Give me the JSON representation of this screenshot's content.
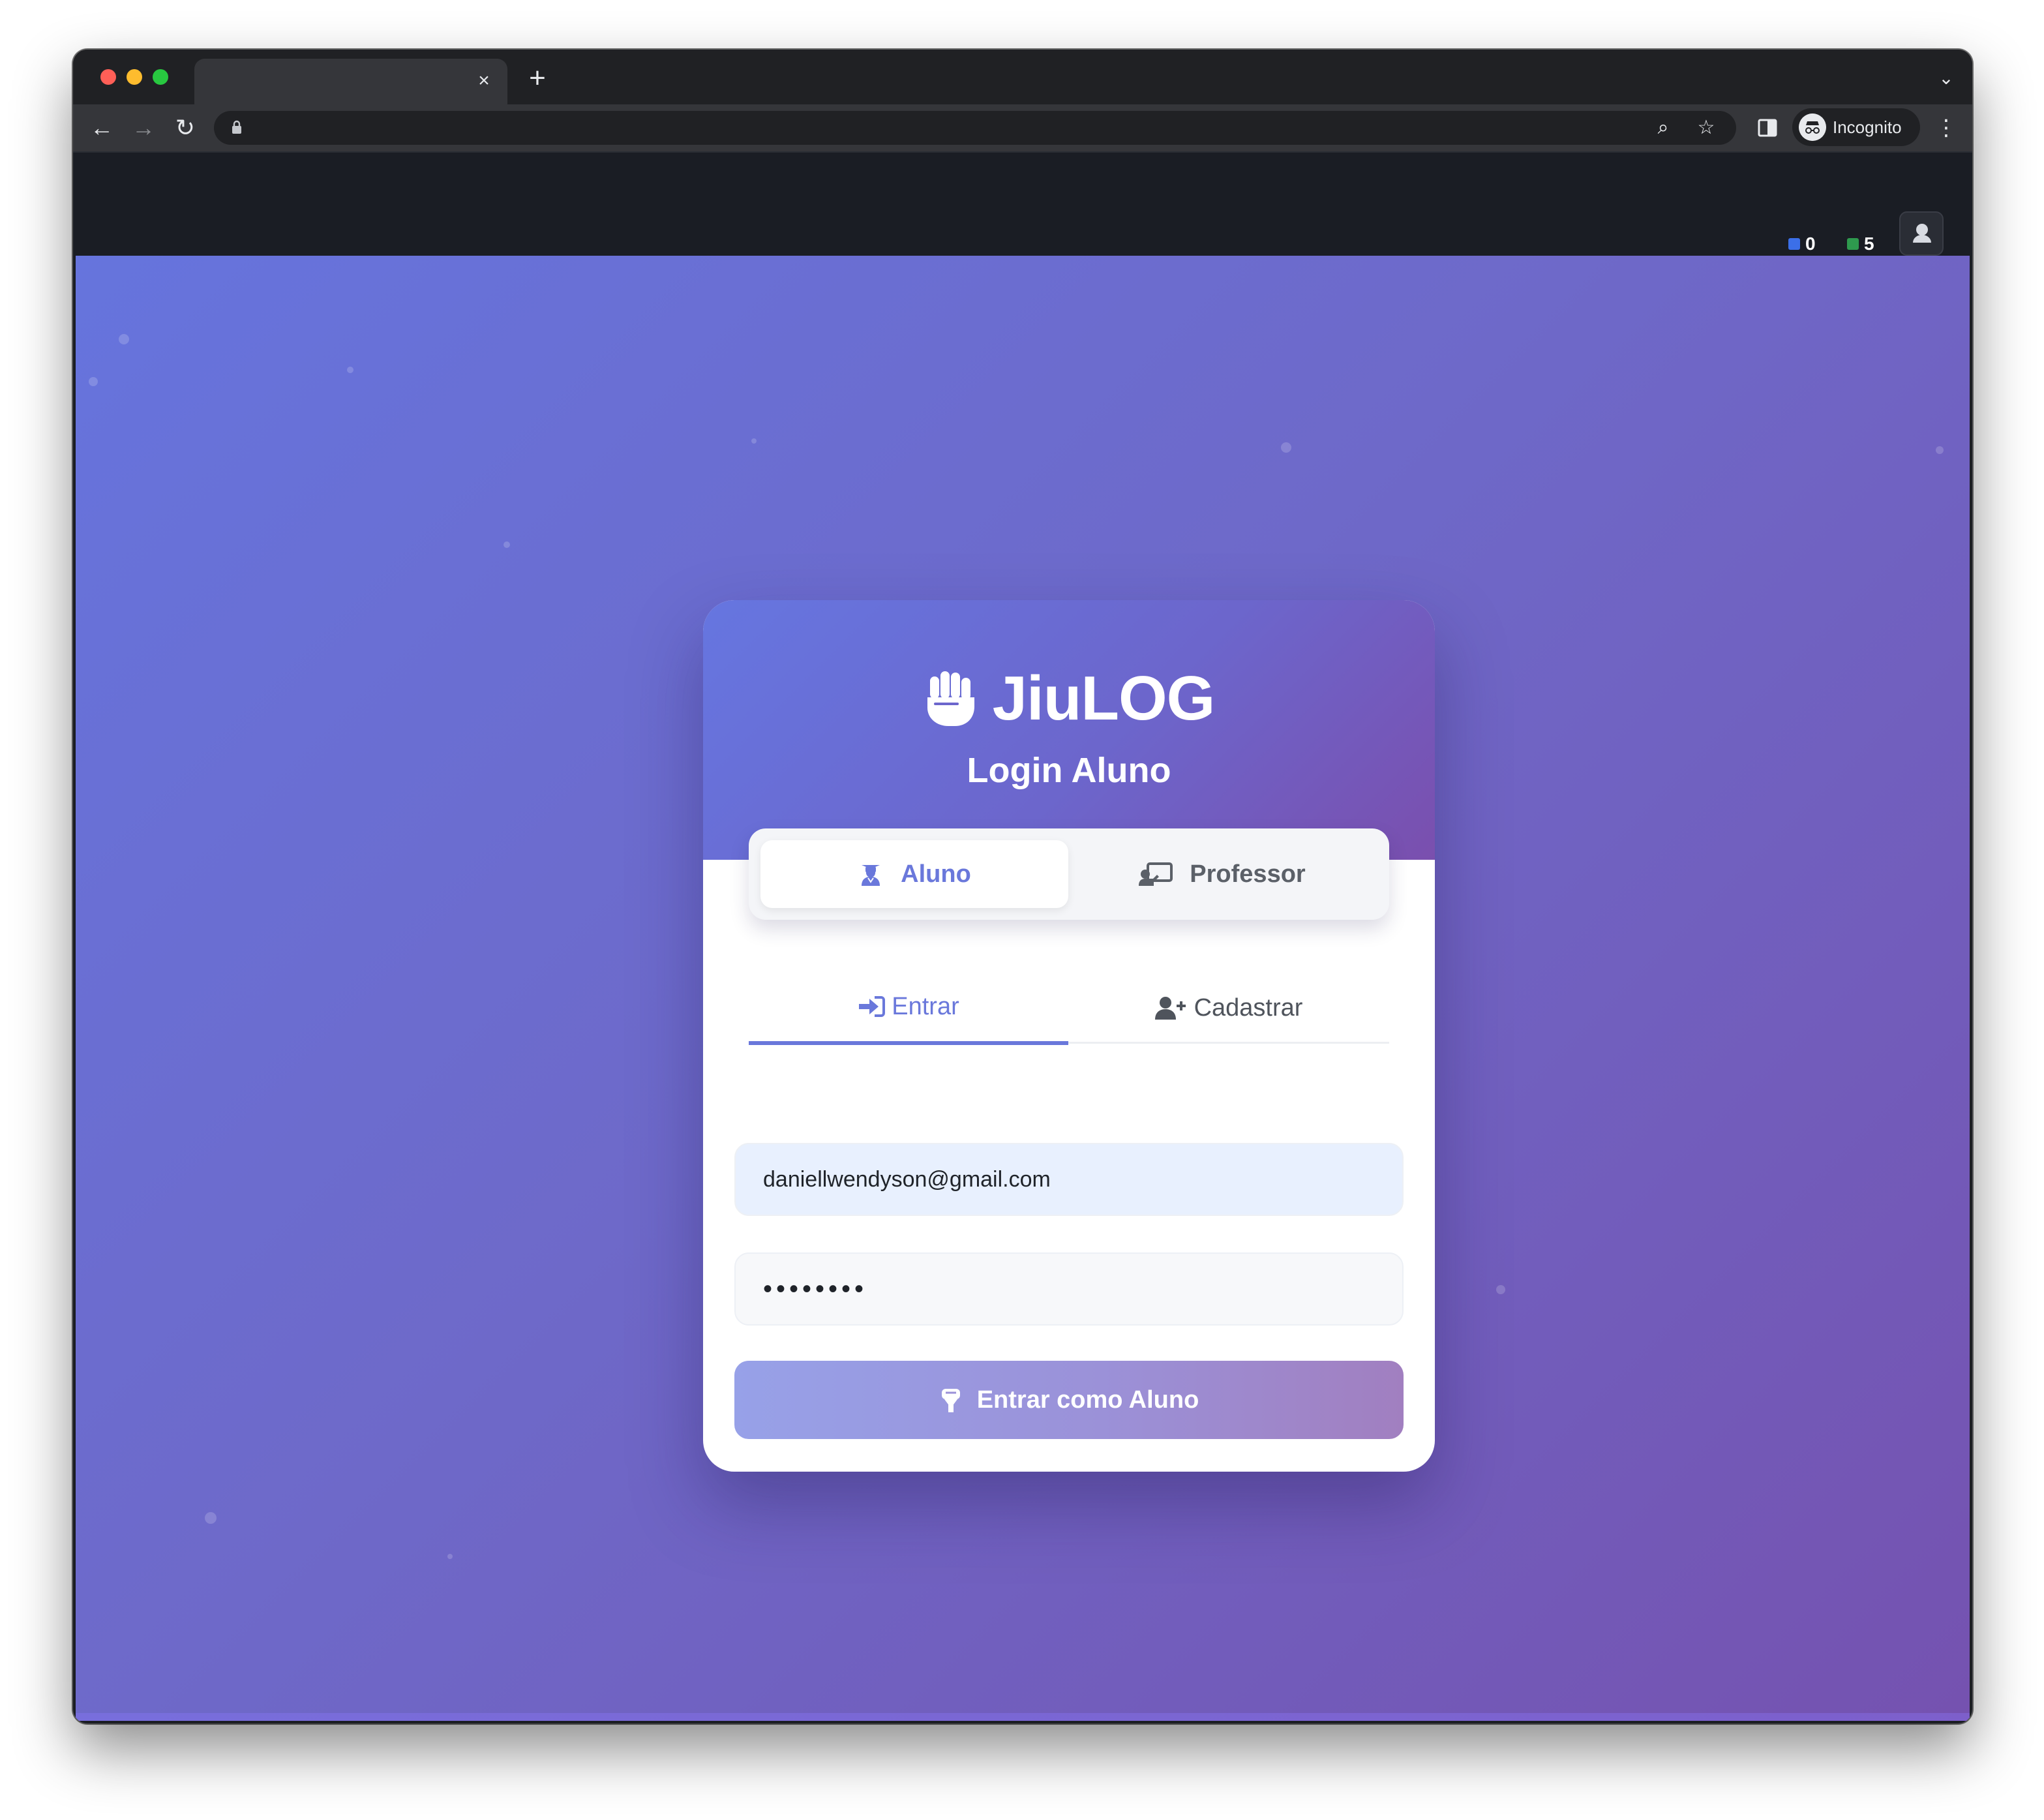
{
  "browser": {
    "tab_close_glyph": "×",
    "new_tab_glyph": "+",
    "tab_menu_glyph": "⌄",
    "back_glyph": "←",
    "forward_glyph": "→",
    "reload_glyph": "↻",
    "zoom_glyph": "⌕",
    "star_glyph": "☆",
    "kebab_glyph": "⋮",
    "incognito_label": "Incognito"
  },
  "header": {
    "counters": [
      {
        "value": "0",
        "color": "#3b6fe8"
      },
      {
        "value": "5",
        "color": "#2e9a4e"
      }
    ]
  },
  "card": {
    "brand": "JiuLOG",
    "subtitle": "Login Aluno",
    "role_tabs": [
      {
        "label": "Aluno",
        "icon": "graduate-icon",
        "active": true
      },
      {
        "label": "Professor",
        "icon": "chalkboard-teacher-icon",
        "active": false
      }
    ],
    "auth_tabs": [
      {
        "label": "Entrar",
        "icon": "sign-in-icon",
        "active": true
      },
      {
        "label": "Cadastrar",
        "icon": "user-plus-icon",
        "active": false
      }
    ],
    "email": {
      "value": "daniellwendyson@gmail.com"
    },
    "password": {
      "value": "••••••••"
    },
    "submit_label": "Entrar como Aluno"
  },
  "colors": {
    "accent": "#6a78db",
    "page_gradient_start": "#6674dd",
    "page_gradient_end": "#7552b0"
  }
}
